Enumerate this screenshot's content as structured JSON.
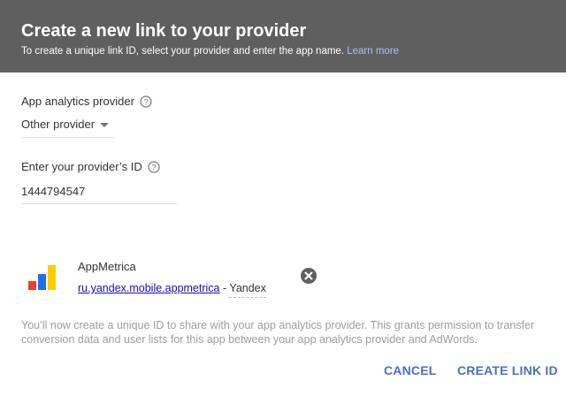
{
  "dialog": {
    "title": "Create a new link to your provider",
    "subtitle": "To create a unique link ID, select your provider and enter the app name.",
    "learn_more": "Learn more"
  },
  "provider_field": {
    "label": "App analytics provider",
    "value": "Other provider"
  },
  "id_field": {
    "label": "Enter your provider’s ID",
    "value": "1444794547"
  },
  "app": {
    "name": "AppMetrica",
    "package": "ru.yandex.mobile.appmetrica",
    "separator": "-",
    "store": "Yandex",
    "logo_colors": [
      "#ef3b36",
      "#1e6fe8",
      "#ffcc00"
    ]
  },
  "info_text": "You’ll now create a unique ID to share with your app analytics provider. This grants permission to transfer conversion data and user lists for this app between your app analytics provider and AdWords.",
  "actions": {
    "cancel": "CANCEL",
    "create": "CREATE LINK ID"
  },
  "colors": {
    "header_bg": "#5f5f5f",
    "accent": "#4a6fc7",
    "link": "#1a0dab"
  }
}
